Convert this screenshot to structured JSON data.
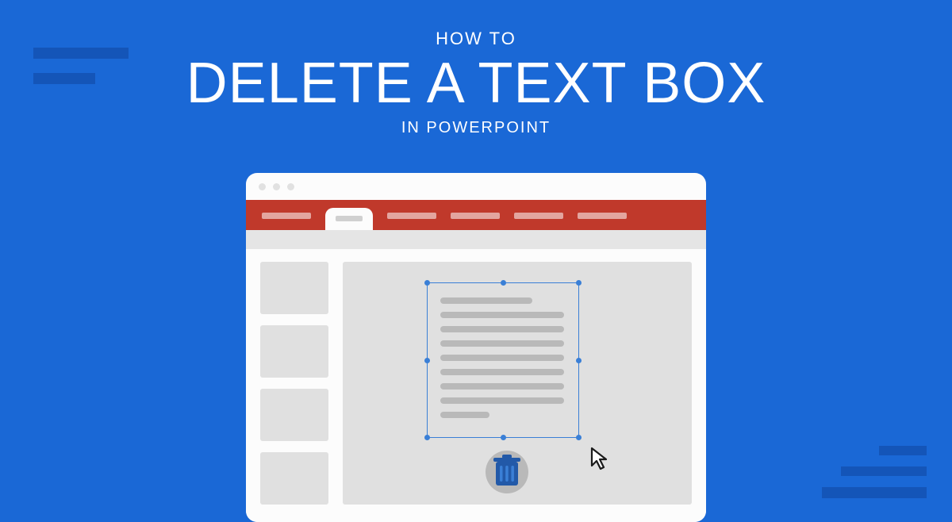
{
  "heading": {
    "line1": "HOW TO",
    "line2": "DELETE A TEXT BOX",
    "line3": "IN POWERPOINT"
  }
}
